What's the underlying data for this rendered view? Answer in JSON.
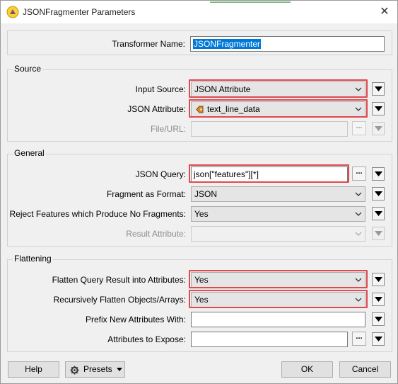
{
  "window": {
    "title": "JSONFragmenter Parameters",
    "close_glyph": "✕"
  },
  "transformer": {
    "label": "Transformer Name:",
    "value": "JSONFragmenter"
  },
  "source": {
    "title": "Source",
    "input_source": {
      "label": "Input Source:",
      "value": "JSON Attribute"
    },
    "json_attribute": {
      "label": "JSON Attribute:",
      "value": "text_line_data"
    },
    "file_url": {
      "label": "File/URL:",
      "value": ""
    }
  },
  "general": {
    "title": "General",
    "json_query": {
      "label": "JSON Query:",
      "value": "json[\"features\"][*]"
    },
    "fragment_format": {
      "label": "Fragment as Format:",
      "value": "JSON"
    },
    "reject": {
      "label": "Reject Features which Produce No Fragments:",
      "value": "Yes"
    },
    "result_attribute": {
      "label": "Result Attribute:",
      "value": ""
    }
  },
  "flattening": {
    "title": "Flattening",
    "flatten_query": {
      "label": "Flatten Query Result into Attributes:",
      "value": "Yes"
    },
    "recursive": {
      "label": "Recursively Flatten Objects/Arrays:",
      "value": "Yes"
    },
    "prefix": {
      "label": "Prefix New Attributes With:",
      "value": ""
    },
    "expose": {
      "label": "Attributes to Expose:",
      "value": ""
    }
  },
  "buttons": {
    "ellipsis": "...",
    "help": "Help",
    "presets": "Presets",
    "ok": "OK",
    "cancel": "Cancel"
  },
  "colors": {
    "highlight": "#e04a4f",
    "selection": "#0078d7"
  }
}
